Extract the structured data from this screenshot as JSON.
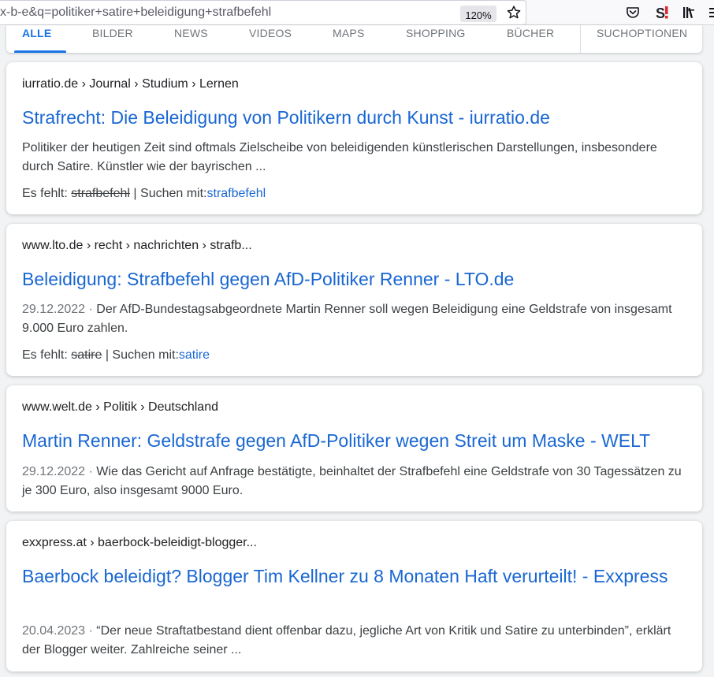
{
  "browser": {
    "url": "x-b-e&q=politiker+satire+beleidigung+strafbefehl",
    "zoom": "120%",
    "icons": [
      "star-icon",
      "pocket-icon",
      "s-extension-icon",
      "library-icon",
      "overflow-icon"
    ]
  },
  "tabs": [
    {
      "label": "ALLE",
      "active": true
    },
    {
      "label": "BILDER"
    },
    {
      "label": "NEWS"
    },
    {
      "label": "VIDEOS"
    },
    {
      "label": "MAPS"
    },
    {
      "label": "SHOPPING"
    },
    {
      "label": "BÜCHER"
    },
    {
      "label": "SUCHOPTIONEN"
    }
  ],
  "results": [
    {
      "breadcrumb": "iurratio.de › Journal › Studium › Lernen",
      "title": "Strafrecht: Die Beleidigung von Politikern durch Kunst - iurratio.de",
      "date": "",
      "snippet": "Politiker der heutigen Zeit sind oftmals Zielscheibe von beleidigenden künstlerischen Darstellungen, insbesondere durch Satire. Künstler wie der bayrischen ...",
      "missing_label": "Es fehlt: ",
      "missing_term": "strafbefehl",
      "search_with_label": " | Suchen mit:",
      "search_with_term": "strafbefehl"
    },
    {
      "breadcrumb": "www.lto.de › recht › nachrichten › strafb...",
      "title": "Beleidigung: Strafbefehl gegen AfD-Politiker Renner - LTO.de",
      "date": "29.12.2022 · ",
      "snippet": "Der AfD-Bundestagsabgeordnete Martin Renner soll wegen Beleidigung eine Geldstrafe von insgesamt 9.000 Euro zahlen.",
      "missing_label": "Es fehlt: ",
      "missing_term": "satire",
      "search_with_label": " | Suchen mit:",
      "search_with_term": "satire"
    },
    {
      "breadcrumb": "www.welt.de › Politik › Deutschland",
      "title": "Martin Renner: Geldstrafe gegen AfD-Politiker wegen Streit um Maske - WELT",
      "date": "29.12.2022 · ",
      "snippet": "Wie das Gericht auf Anfrage bestätigte, beinhaltet der Strafbefehl eine Geldstrafe von 30 Tagessätzen zu je 300 Euro, also insgesamt 9000 Euro."
    },
    {
      "breadcrumb": "exxpress.at › baerbock-beleidigt-blogger...",
      "title": "Baerbock beleidigt? Blogger Tim Kellner zu 8 Monaten Haft verurteilt! - Exxpress",
      "date": "20.04.2023 · ",
      "snippet": "“Der neue Straftatbestand dient offenbar dazu, jegliche Art von Kritik und Satire zu unterbinden”, erklärt der Blogger weiter. Zahlreiche seiner ..."
    }
  ],
  "colors": {
    "link": "#1967d2",
    "accent": "#1a73e8",
    "text": "#202124",
    "muted": "#70757a",
    "extension_red": "#e0282e"
  }
}
